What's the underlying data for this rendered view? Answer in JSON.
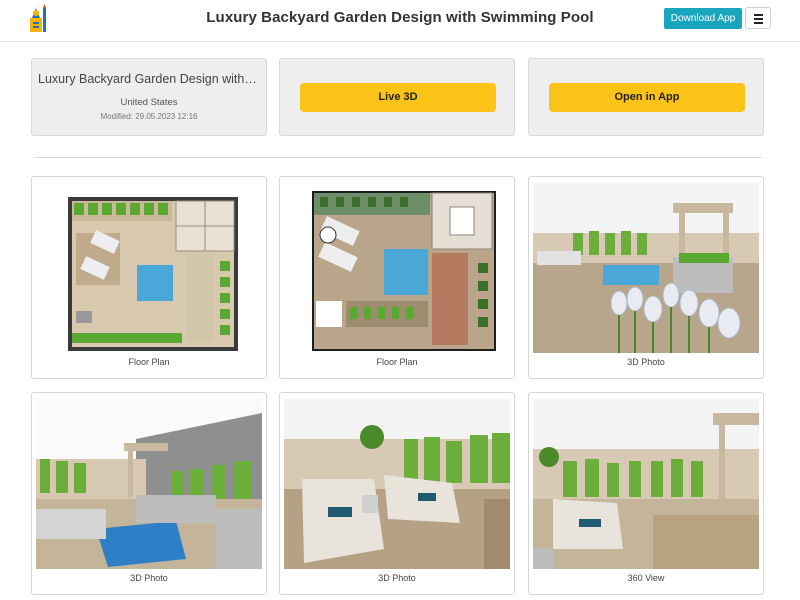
{
  "header": {
    "title": "Luxury Backyard Garden Design with Swimming Pool",
    "download_label": "Download App",
    "logo_icon": "roomsketcher-logo-icon",
    "menu_icon": "hamburger-menu-icon"
  },
  "info": {
    "title": "Luxury Backyard Garden Design with S...",
    "country": "United States",
    "modified": "Modified: 29.05.2023 12:16"
  },
  "actions": {
    "live3d_label": "Live 3D",
    "open_app_label": "Open in App"
  },
  "colors": {
    "accent_teal": "#1aa5bf",
    "accent_yellow": "#fbc218",
    "panel_bg": "#eeeeee"
  },
  "gallery": [
    {
      "caption": "Floor Plan"
    },
    {
      "caption": "Floor Plan"
    },
    {
      "caption": "3D Photo"
    },
    {
      "caption": "3D Photo"
    },
    {
      "caption": "3D Photo"
    },
    {
      "caption": "360 View"
    }
  ]
}
